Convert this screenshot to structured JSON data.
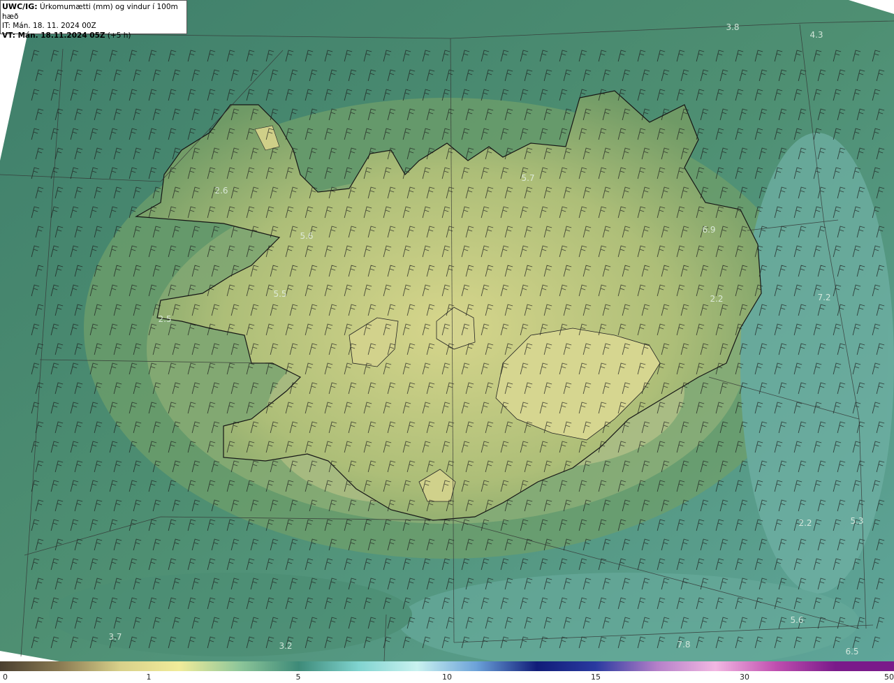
{
  "header": {
    "title_bold": "UWC/IG:",
    "title_rest": " Úrkomumætti (mm) og vindur í 100m hæð",
    "it_line": "IT: Mán. 18. 11. 2024 00Z",
    "vt_bold": "VT: Mán. 18.11.2024 05Z",
    "vt_rest": " (+5 h)"
  },
  "contour_labels": [
    {
      "text": "3.8"
    },
    {
      "text": "4.3"
    },
    {
      "text": "5.7"
    },
    {
      "text": "2.6"
    },
    {
      "text": "5.6"
    },
    {
      "text": "6.9"
    },
    {
      "text": "5.5"
    },
    {
      "text": "7.2"
    },
    {
      "text": "2.2"
    },
    {
      "text": "5.3"
    },
    {
      "text": "2.2"
    },
    {
      "text": "3.7"
    },
    {
      "text": "3.2"
    },
    {
      "text": "7.8"
    },
    {
      "text": "5.6"
    },
    {
      "text": "6.5"
    },
    {
      "text": "2.5"
    }
  ],
  "colorbar": {
    "ticks": [
      "0",
      "1",
      "5",
      "10",
      "15",
      "30",
      "50"
    ],
    "colors": [
      "#4a3f2f",
      "#8a7a52",
      "#d8d08a",
      "#f1ec9a",
      "#8fc79a",
      "#3d8a78",
      "#7fd3cf",
      "#c9f2f0",
      "#6aa0d8",
      "#101c78",
      "#2a3aa0",
      "#b37fc8",
      "#f2b7e2",
      "#c050b0",
      "#7a1a8a"
    ]
  },
  "colors": {
    "sea": "#3f7e6c",
    "land_low": "#7aa065",
    "land_high": "#cfd189",
    "coast": "#111111",
    "barb": "#1a1a1a"
  }
}
